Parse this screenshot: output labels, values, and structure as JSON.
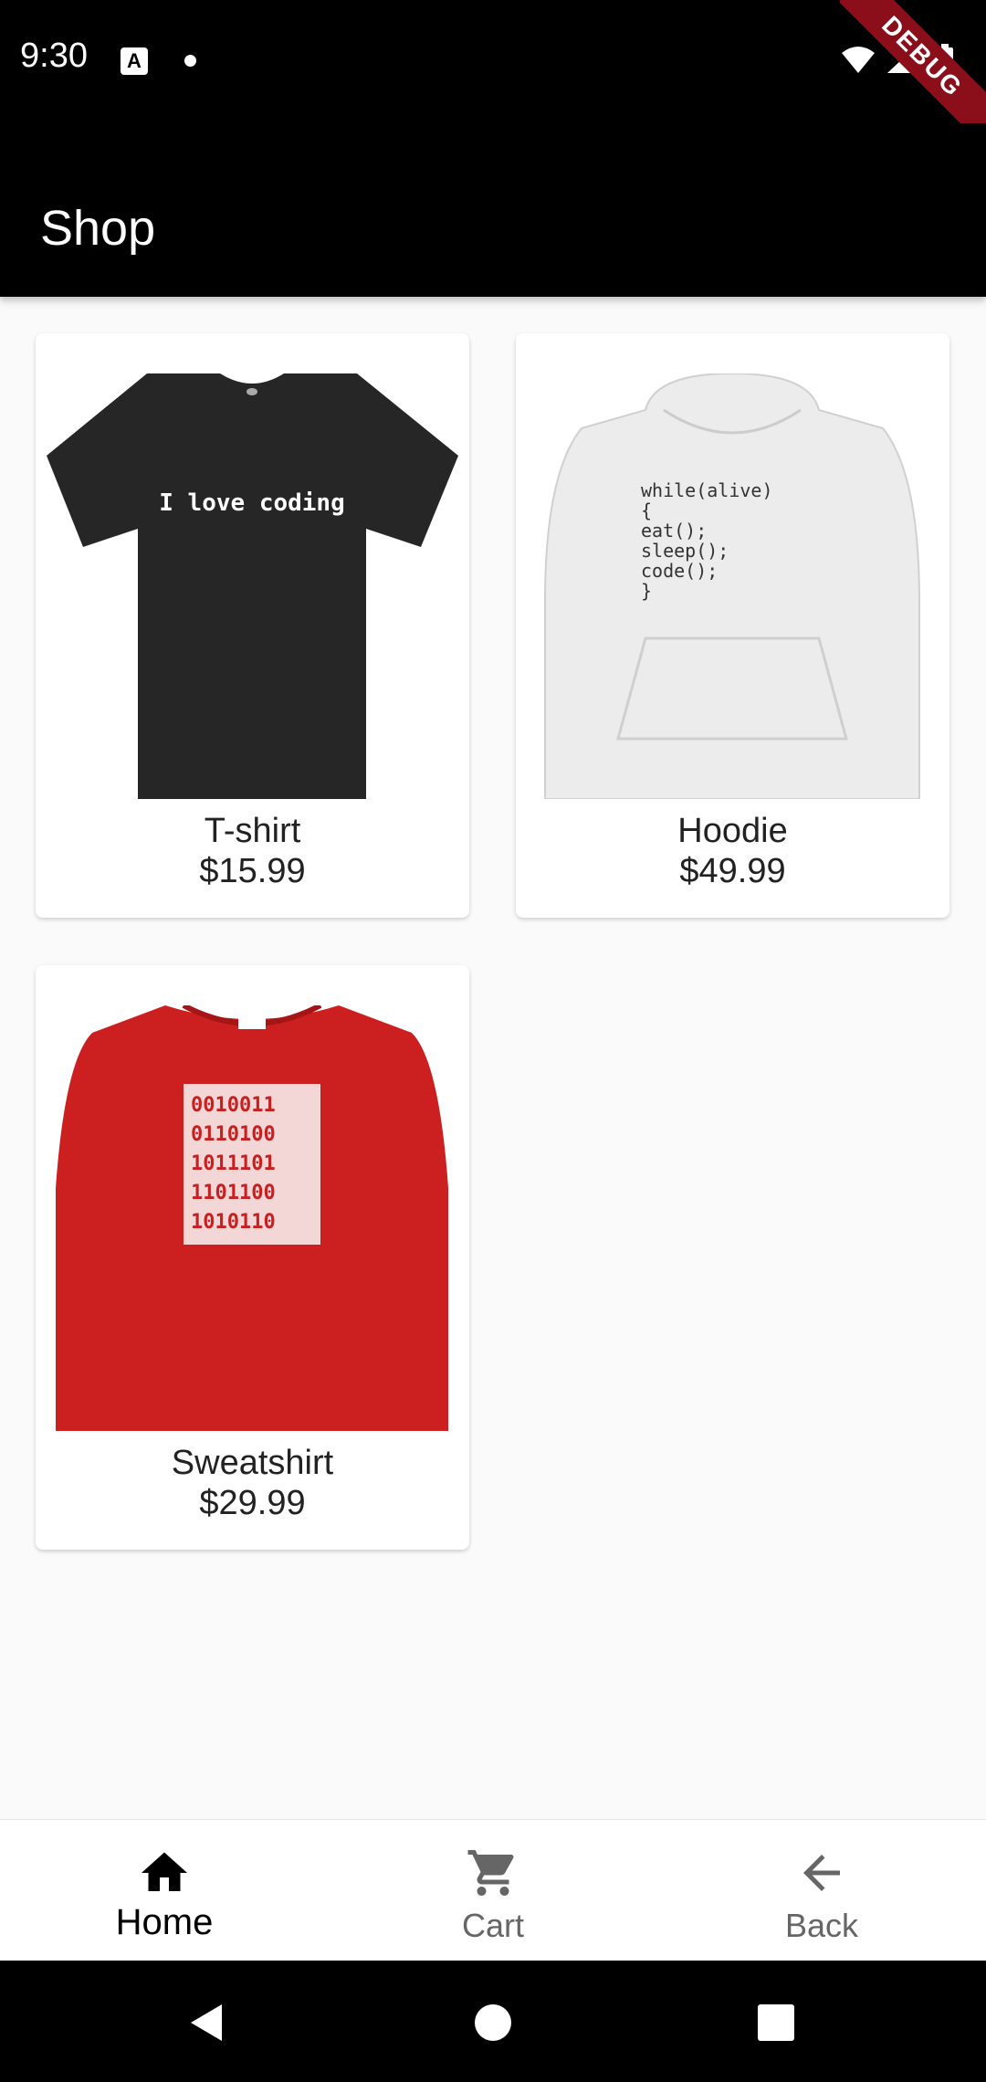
{
  "status": {
    "time": "9:30",
    "a_badge": "A",
    "debug": "DEBUG"
  },
  "app_bar": {
    "title": "Shop"
  },
  "products": [
    {
      "name": "T-shirt",
      "price": "$15.99",
      "print_text": "I love coding",
      "color": "#262626"
    },
    {
      "name": "Hoodie",
      "price": "$49.99",
      "print_lines": [
        "while(alive)",
        "{",
        "eat();",
        "sleep();",
        "code();",
        "}"
      ],
      "color": "#ececec"
    },
    {
      "name": "Sweatshirt",
      "price": "$29.99",
      "print_lines": [
        "0010011",
        "0110100",
        "1011101",
        "1101100",
        "1010110"
      ],
      "color": "#cc1f1f"
    }
  ],
  "bottom_nav": {
    "home": "Home",
    "cart": "Cart",
    "back": "Back"
  }
}
